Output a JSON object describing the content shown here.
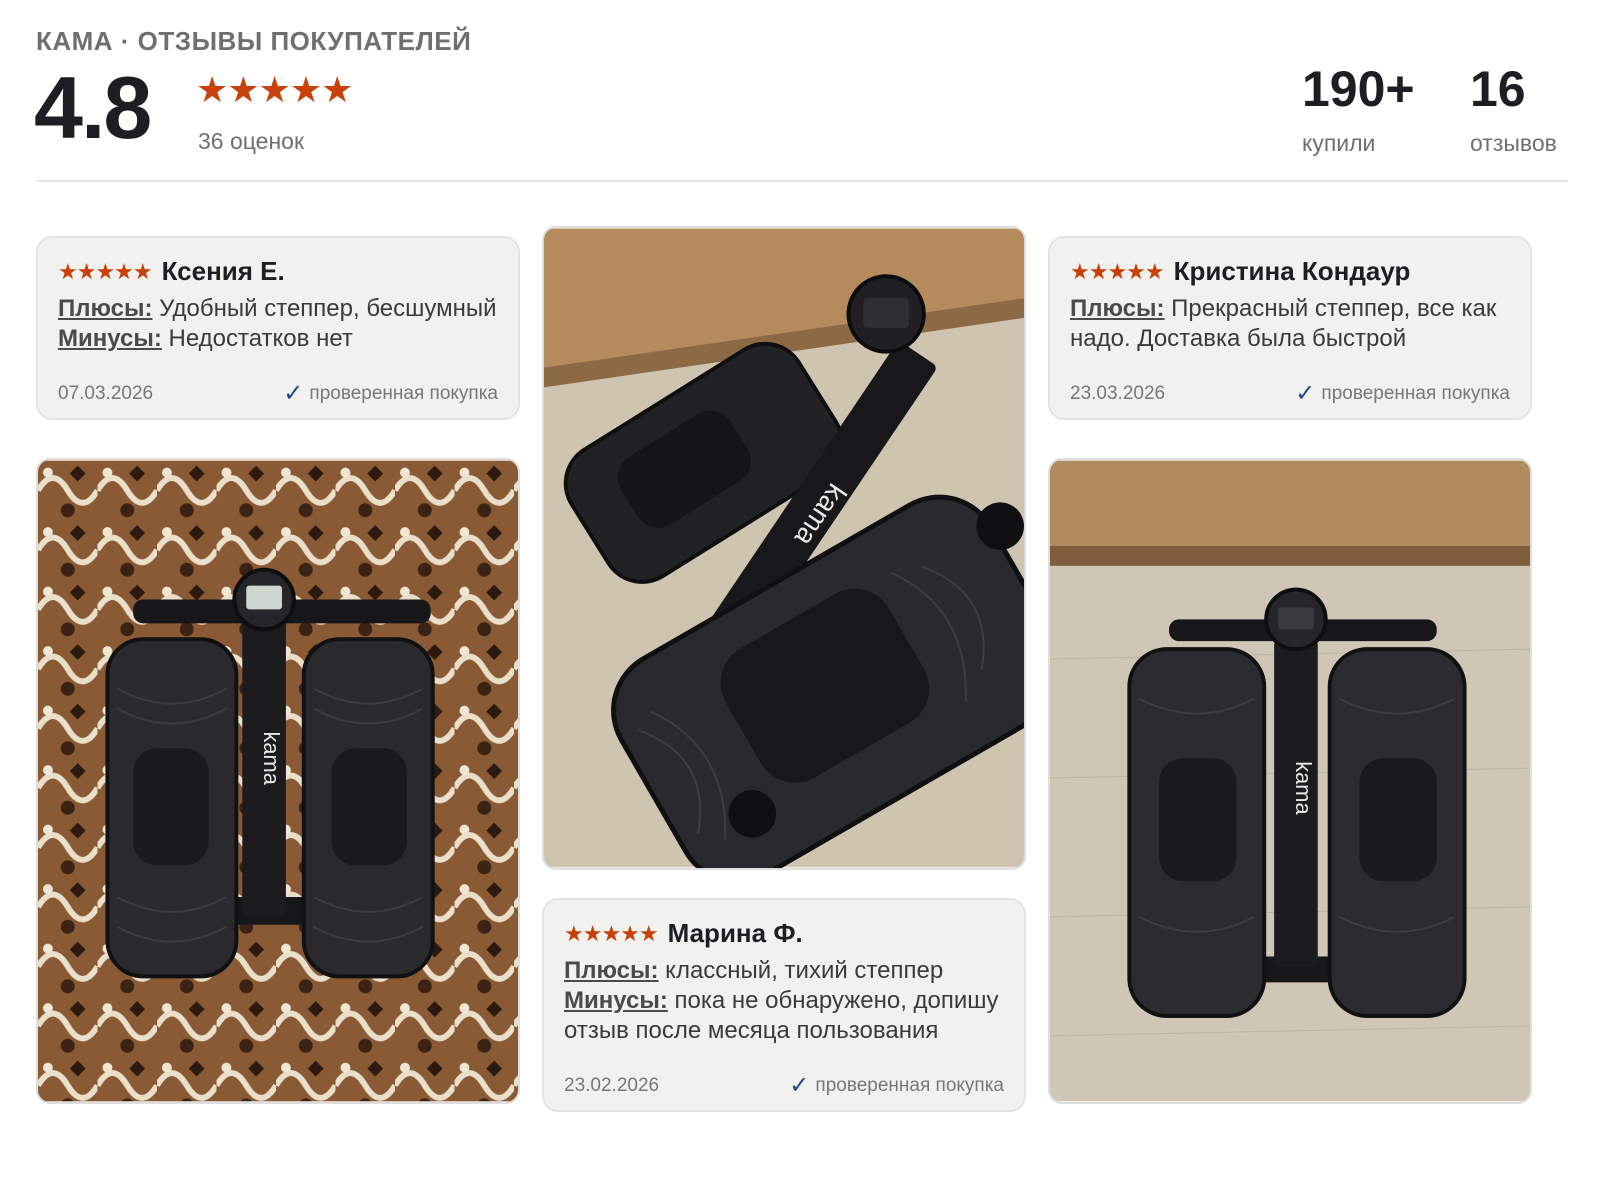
{
  "header": {
    "brand": "КАМА · ОТЗЫВЫ ПОКУПАТЕЛЕЙ",
    "rating": "4.8",
    "stars": "★★★★★",
    "rating_count": "36 оценок",
    "bought_value": "190+",
    "bought_label": "купили",
    "reviews_value": "16",
    "reviews_label": "отзывов"
  },
  "reviews": [
    {
      "stars": "★★★★★",
      "name": "Ксения Е.",
      "pros_label": "Плюсы:",
      "pros": " Удобный степпер, бесшумный",
      "cons_label": "Минусы:",
      "cons": " Недостатков нет",
      "date": "07.03.2026",
      "verified": "проверенная покупка"
    },
    {
      "stars": "★★★★★",
      "name": "Кристина Кондаур",
      "pros_label": "Плюсы:",
      "pros": " Прекрасный степпер, все как надо. Доставка была быстрой",
      "date": "23.03.2026",
      "verified": "проверенная покупка"
    },
    {
      "stars": "★★★★★",
      "name": "Марина Ф.",
      "pros_label": "Плюсы:",
      "pros": " классный, тихий степпер",
      "cons_label": "Минусы:",
      "cons": " пока не обнаружено, допишу отзыв после месяца пользования",
      "date": "23.02.2026",
      "verified": "проверенная покупка"
    }
  ],
  "photos": {
    "brand_mark": "kama",
    "colors": {
      "rug": "#8a5a34",
      "floor": "#cfc4b0",
      "wood": "#b58a5c",
      "stepper": "#1e1e20"
    }
  },
  "colors": {
    "accent_star": "#c8410a",
    "check": "#1d4a8a",
    "card_bg": "#f1f1f0"
  }
}
